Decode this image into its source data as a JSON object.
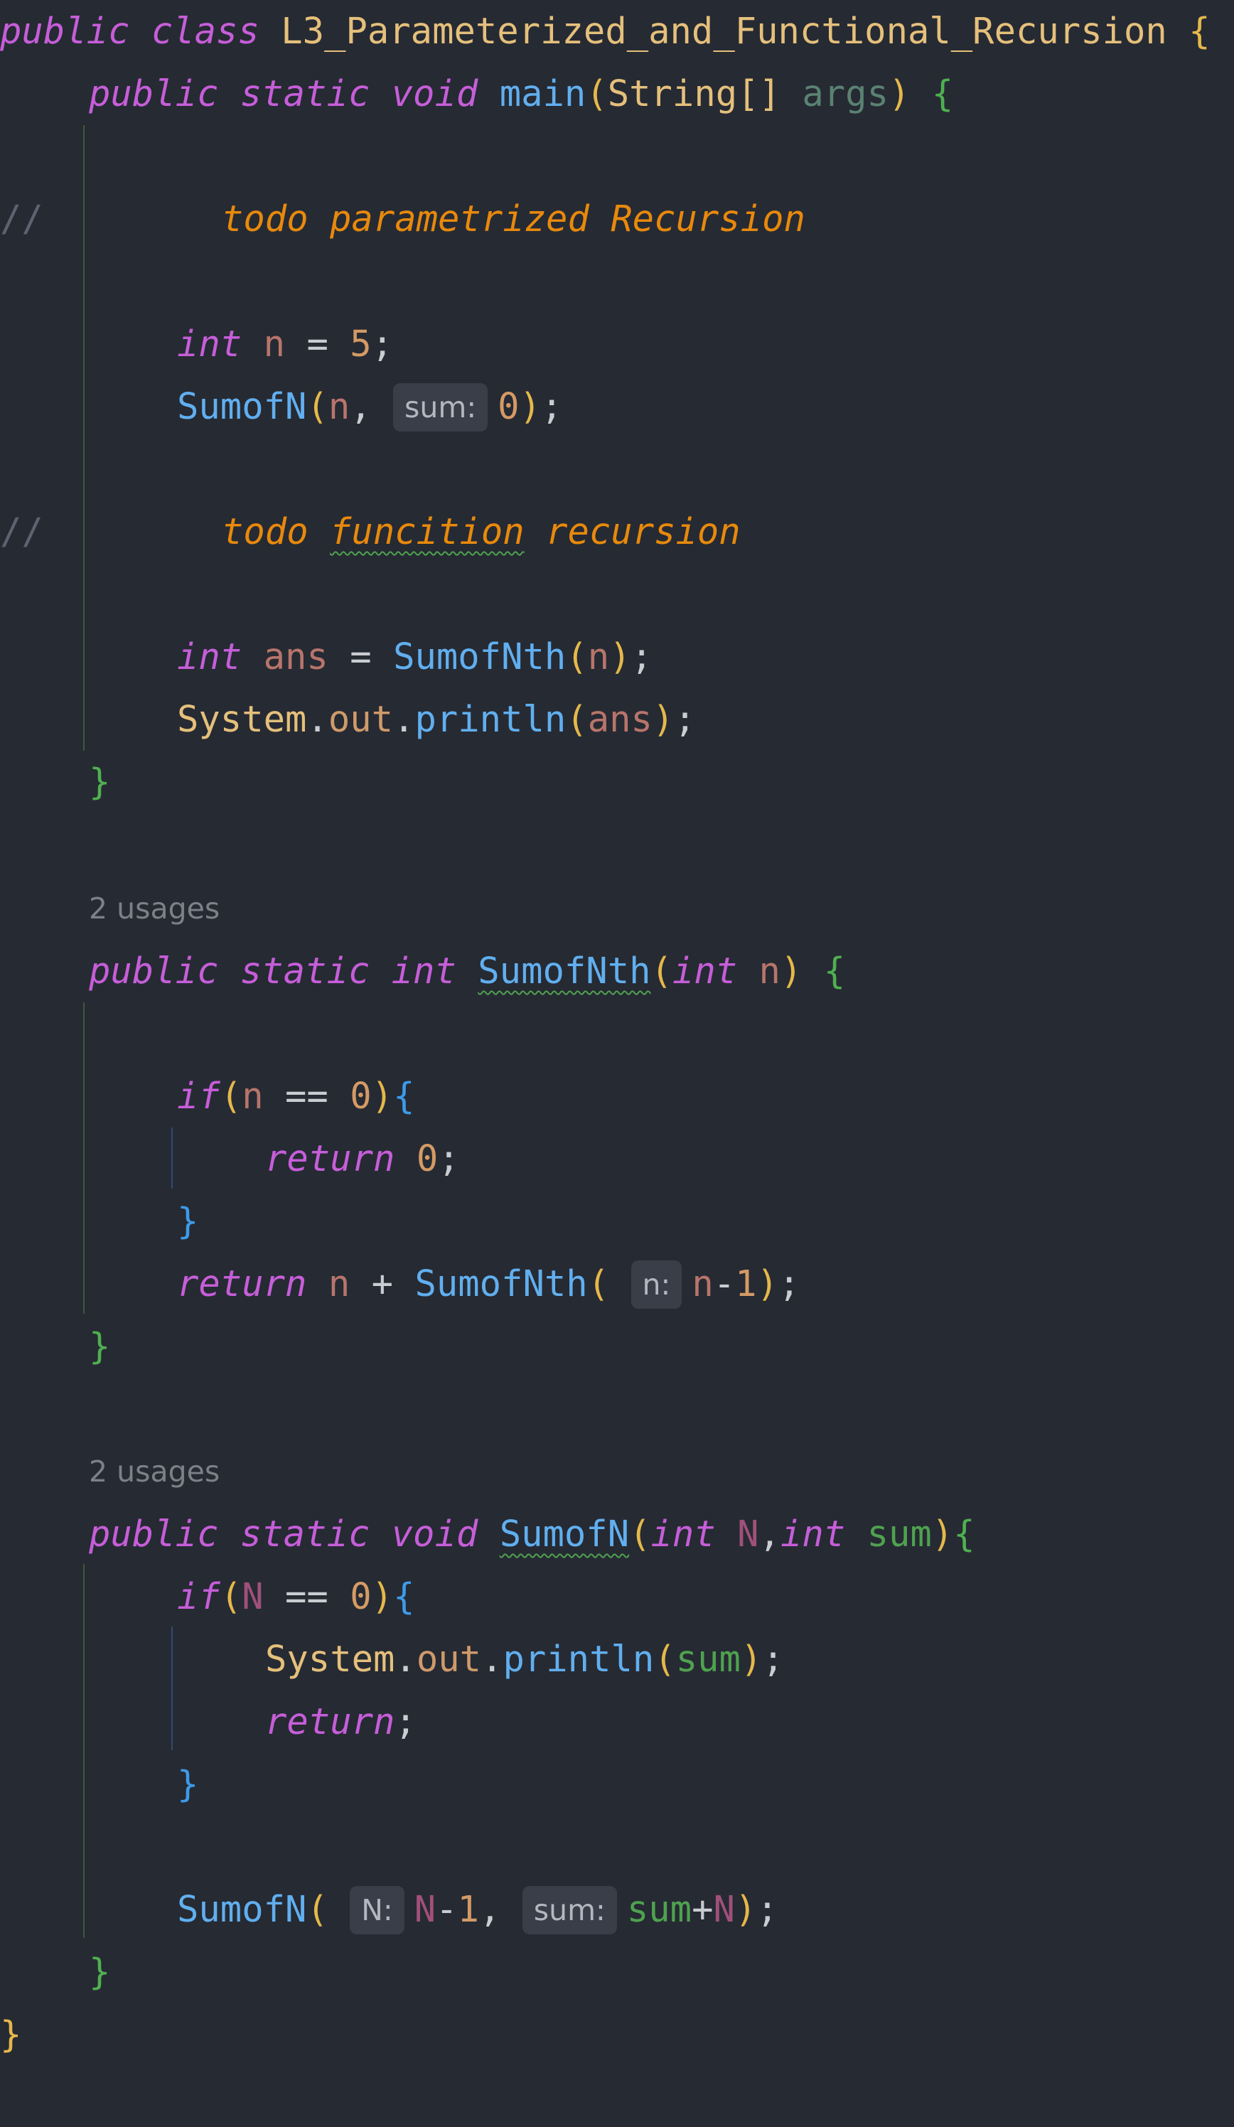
{
  "colors": {
    "background": "#262a33",
    "keyword": "#c65ed9",
    "method": "#61afef",
    "todo_comment": "#e8890c",
    "inlay_hint_bg": "#393e48",
    "usages": "#7c8087"
  },
  "code": {
    "class_kw_public": "public",
    "class_kw_class": "class",
    "class_name": "L3_Parameterized_and_Functional_Recursion",
    "main_kw_public": "public",
    "main_kw_static": "static",
    "main_kw_void": "void",
    "main_name": "main",
    "main_param_type": "String[]",
    "main_param_name": "args",
    "comment_prefix": "//",
    "todo1": "todo parametrized Recursion",
    "todo2_a": "todo ",
    "todo2_b": "funcition",
    "todo2_c": " recursion",
    "int_kw": "int",
    "var_n": "n",
    "num_5": "5",
    "call_sumofn": "SumofN",
    "hint_sum": "sum:",
    "num_0": "0",
    "var_ans": "ans",
    "call_sumofnth": "SumofNth",
    "system": "System",
    "out": "out",
    "println": "println",
    "usages_1": "2 usages",
    "m2_kw_public": "public",
    "m2_kw_static": "static",
    "m2_ret": "int",
    "m2_name": "SumofNth",
    "m2_param_type": "int",
    "m2_param_name": "n",
    "if_kw": "if",
    "return_kw": "return",
    "hint_n": "n:",
    "one": "1",
    "usages_2": "2 usages",
    "m3_kw_public": "public",
    "m3_kw_static": "static",
    "m3_ret": "void",
    "m3_name": "SumofN",
    "m3_param1_type": "int",
    "m3_param1_name": "N",
    "m3_param2_type": "int",
    "m3_param2_name": "sum",
    "hint_N": "N:"
  }
}
